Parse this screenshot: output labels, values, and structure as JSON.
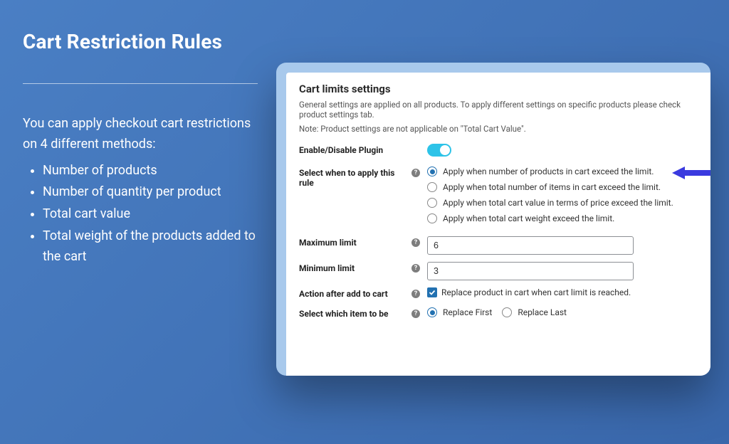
{
  "left": {
    "title": "Cart Restriction Rules",
    "intro": "You can apply checkout cart restrictions on 4 different methods:",
    "bullets": [
      "Number of products",
      "Number of quantity per product",
      "Total cart value",
      "Total weight of the products added to the cart"
    ]
  },
  "panel": {
    "title": "Cart limits settings",
    "description": "General settings are applied on all products. To apply different settings on specific products please check product settings tab.",
    "note": "Note: Product settings are not applicable on \"Total Cart Value\".",
    "enable_label": "Enable/Disable Plugin",
    "enable_value": true,
    "rule_label": "Select when to apply this rule",
    "rule_options": [
      "Apply when number of products in cart exceed the limit.",
      "Apply when total number of items in cart exceed the limit.",
      "Apply when total cart value in terms of price exceed the limit.",
      "Apply when total cart weight exceed the limit."
    ],
    "rule_selected_index": 0,
    "max_label": "Maximum limit",
    "max_value": "6",
    "min_label": "Minimum limit",
    "min_value": "3",
    "action_label": "Action after add to cart",
    "action_checkbox_label": "Replace product in cart when cart limit is reached.",
    "action_checkbox_checked": true,
    "replace_label": "Select which item to be",
    "replace_options": [
      "Replace First",
      "Replace Last"
    ],
    "replace_selected_index": 0
  }
}
